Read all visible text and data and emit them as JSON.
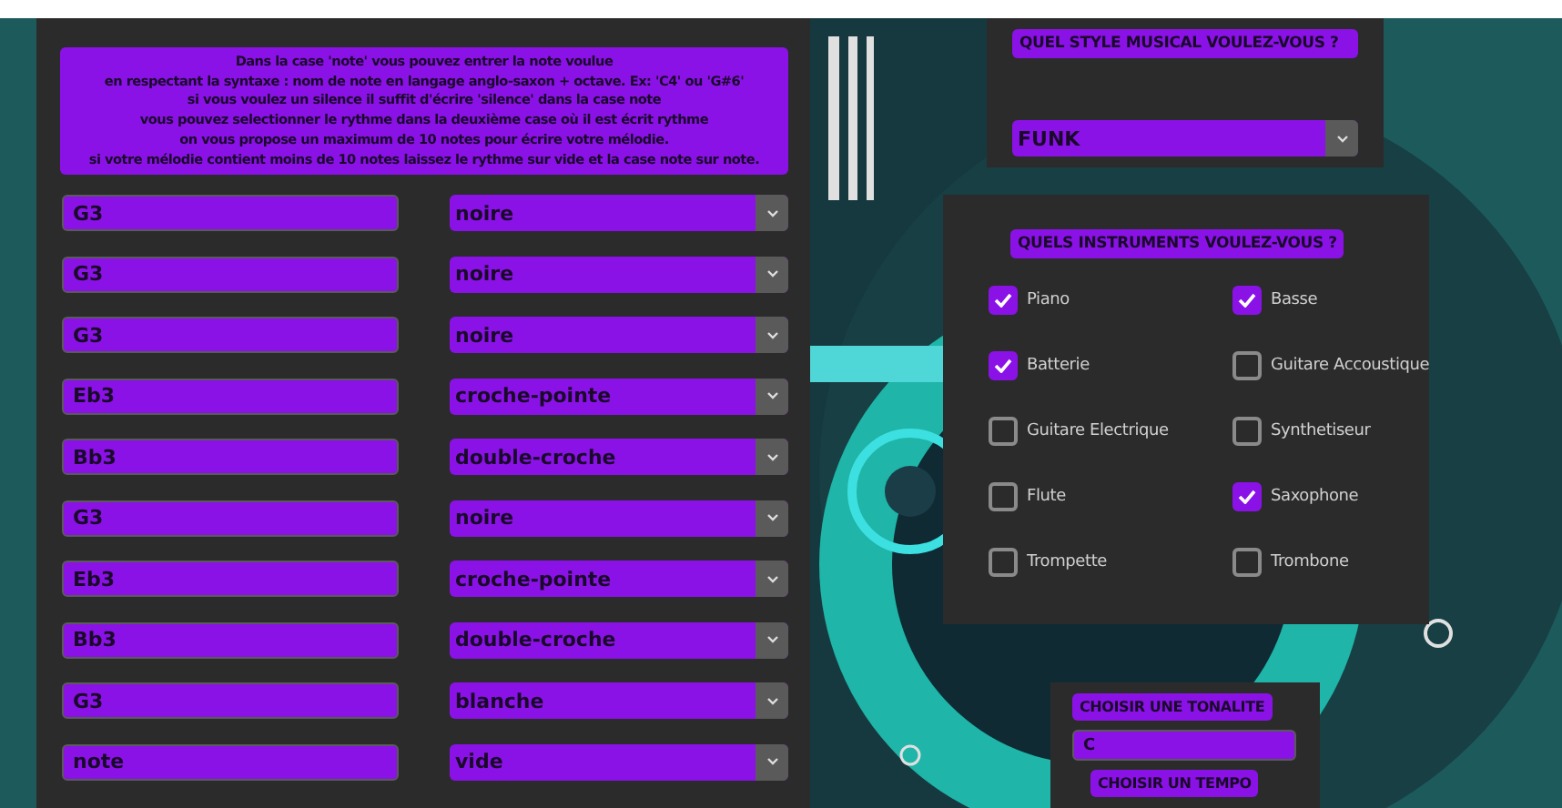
{
  "instructions": [
    "Dans la case 'note' vous pouvez entrer la note voulue",
    "en respectant la syntaxe : nom de note en langage anglo-saxon + octave. Ex: 'C4' ou 'G#6'",
    "si vous voulez un silence il suffit d'écrire 'silence' dans la case note",
    "vous pouvez selectionner le rythme dans la deuxième case où il est écrit rythme",
    "on vous propose un maximum de 10 notes pour écrire votre mélodie.",
    "si votre mélodie contient moins de 10 notes laissez le rythme sur vide et la case note sur note."
  ],
  "notes": [
    {
      "note": "G3",
      "rhythm": "noire"
    },
    {
      "note": "G3",
      "rhythm": "noire"
    },
    {
      "note": "G3",
      "rhythm": "noire"
    },
    {
      "note": "Eb3",
      "rhythm": "croche-pointe"
    },
    {
      "note": "Bb3",
      "rhythm": "double-croche"
    },
    {
      "note": "G3",
      "rhythm": "noire"
    },
    {
      "note": "Eb3",
      "rhythm": "croche-pointe"
    },
    {
      "note": "Bb3",
      "rhythm": "double-croche"
    },
    {
      "note": "G3",
      "rhythm": "blanche"
    },
    {
      "note": "note",
      "rhythm": "vide"
    }
  ],
  "style": {
    "heading": "QUEL STYLE MUSICAL VOULEZ-VOUS ?",
    "value": "FUNK"
  },
  "instruments": {
    "heading": "QUELS INSTRUMENTS VOULEZ-VOUS ?",
    "items": [
      {
        "label": "Piano",
        "checked": true
      },
      {
        "label": "Basse",
        "checked": true
      },
      {
        "label": "Batterie",
        "checked": true
      },
      {
        "label": "Guitare Accoustique",
        "checked": false
      },
      {
        "label": "Guitare Electrique",
        "checked": false
      },
      {
        "label": "Synthetiseur",
        "checked": false
      },
      {
        "label": "Flute",
        "checked": false
      },
      {
        "label": "Saxophone",
        "checked": true
      },
      {
        "label": "Trompette",
        "checked": false
      },
      {
        "label": "Trombone",
        "checked": false
      }
    ]
  },
  "tonality": {
    "heading": "CHOISIR UNE TONALITE",
    "value": "C"
  },
  "tempo": {
    "heading": "CHOISIR UN TEMPO"
  }
}
